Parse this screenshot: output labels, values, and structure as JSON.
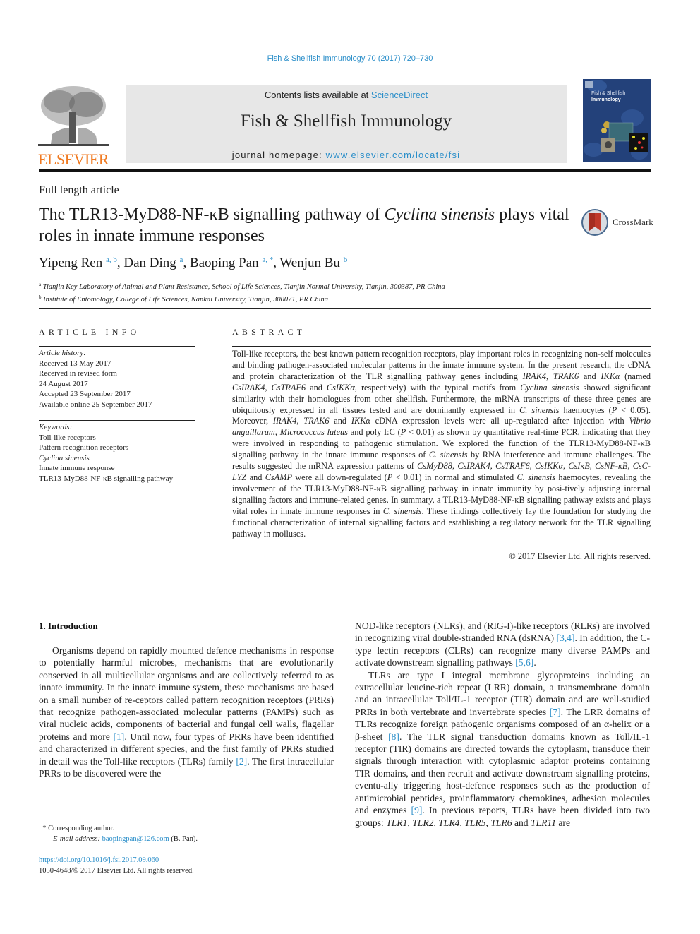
{
  "running_head": "Fish & Shellfish Immunology 70 (2017) 720–730",
  "header": {
    "publisher_logo_text": "ELSEVIER",
    "contents_prefix": "Contents lists available at ",
    "contents_link": "ScienceDirect",
    "journal_name": "Fish & Shellfish Immunology",
    "homepage_prefix": "journal homepage: ",
    "homepage_link": "www.elsevier.com/locate/fsi",
    "cover_title_line1": "Fish & Shellfish",
    "cover_title_line2": "Immunology"
  },
  "article": {
    "type": "Full length article",
    "title_part1": "The TLR13-MyD88-NF-κB signalling pathway of ",
    "title_italic": "Cyclina sinensis",
    "title_part2": " plays vital roles in innate immune responses",
    "crossmark_label": "CrossMark",
    "authors": [
      {
        "name": "Yipeng Ren",
        "sup": "a, b",
        "sep": ", "
      },
      {
        "name": "Dan Ding",
        "sup": "a",
        "sep": ", "
      },
      {
        "name": "Baoping Pan",
        "sup": "a, *",
        "sep": ", "
      },
      {
        "name": "Wenjun Bu",
        "sup": "b",
        "sep": ""
      }
    ],
    "affiliations": [
      {
        "mark": "a",
        "text": "Tianjin Key Laboratory of Animal and Plant Resistance, School of Life Sciences, Tianjin Normal University, Tianjin, 300387, PR China"
      },
      {
        "mark": "b",
        "text": "Institute of Entomology, College of Life Sciences, Nankai University, Tianjin, 300071, PR China"
      }
    ]
  },
  "article_info": {
    "heading": "ARTICLE INFO",
    "history_label": "Article history:",
    "history": [
      "Received 13 May 2017",
      "Received in revised form",
      "24 August 2017",
      "Accepted 23 September 2017",
      "Available online 25 September 2017"
    ],
    "keywords_label": "Keywords:",
    "keywords": [
      "Toll-like receptors",
      "Pattern recognition receptors",
      "Cyclina sinensis",
      "Innate immune response",
      "TLR13-MyD88-NF-κB signalling pathway"
    ]
  },
  "abstract": {
    "heading": "ABSTRACT",
    "text_html": "Toll-like receptors, the best known pattern recognition receptors, play important roles in recognizing non-self molecules and binding pathogen-associated molecular patterns in the innate immune system. In the present research, the cDNA and protein characterization of the TLR signalling pathway genes including <i>IRAK4</i>, <i>TRAK6</i> and <i>IKKα</i> (named <i>CsIRAK4</i>, <i>CsTRAF6</i> and <i>CsIKKα</i>, respectively) with the typical motifs from <i>Cyclina sinensis</i> showed significant similarity with their homologues from other shellfish. Furthermore, the mRNA transcripts of these three genes are ubiquitously expressed in all tissues tested and are dominantly expressed in <i>C. sinensis</i> haemocytes (<i>P</i> &lt; 0.05). Moreover, <i>IRAK4</i>, <i>TRAK6</i> and <i>IKKα</i> cDNA expression levels were all up-regulated after injection with <i>Vibrio anguillarum</i>, <i>Micrococcus luteus</i> and poly I:C (<i>P</i> &lt; 0.01) as shown by quantitative real-time PCR, indicating that they were involved in responding to pathogenic stimulation. We explored the function of the TLR13-MyD88-NF-κB signalling pathway in the innate immune responses of <i>C. sinensis</i> by RNA interference and immune challenges. The results suggested the mRNA expression patterns of <i>CsMyD88</i>, <i>CsIRAK4</i>, <i>CsTRAF6</i>, <i>CsIKKα</i>, <i>CsIκB</i>, <i>CsNF-κB</i>, <i>CsC-LYZ</i> and <i>CsAMP</i> were all down-regulated (<i>P</i> &lt; 0.01) in normal and stimulated <i>C. sinensis</i> haemocytes, revealing the involvement of the TLR13-MyD88-NF-κB signalling pathway in innate immunity by posi-tively adjusting internal signalling factors and immune-related genes. In summary, a TLR13-MyD88-NF-κB signalling pathway exists and plays vital roles in innate immune responses in <i>C. sinensis</i>. These findings collectively lay the foundation for studying the functional characterization of internal signalling factors and establishing a regulatory network for the TLR signalling pathway in molluscs.",
    "copyright": "© 2017 Elsevier Ltd. All rights reserved."
  },
  "body": {
    "section_heading": "1.  Introduction",
    "left_col_html": "Organisms depend on rapidly mounted defence mechanisms in response to potentially harmful microbes, mechanisms that are evolutionarily conserved in all multicellular organisms and are collectively referred to as innate immunity. In the innate immune system, these mechanisms are based on a small number of re-ceptors called pattern recognition receptors (PRRs) that recognize pathogen-associated molecular patterns (PAMPs) such as viral nucleic acids, components of bacterial and fungal cell walls, flagellar proteins and more <span class=\"link\">[1]</span>. Until now, four types of PRRs have been identified and characterized in different species, and the first family of PRRs studied in detail was the Toll-like receptors (TLRs) family <span class=\"link\">[2]</span>. The first intracellular PRRs to be discovered were the",
    "right_col_p1_html": "NOD-like receptors (NLRs), and (RIG-I)-like receptors (RLRs) are involved in recognizing viral double-stranded RNA (dsRNA) <span class=\"link\">[3,4]</span>. In addition, the C-type lectin receptors (CLRs) can recognize many diverse PAMPs and activate downstream signalling pathways <span class=\"link\">[5,6]</span>.",
    "right_col_p2_html": "TLRs are type I integral membrane glycoproteins including an extracellular leucine-rich repeat (LRR) domain, a transmembrane domain and an intracellular Toll/IL-1 receptor (TIR) domain and are well-studied PRRs in both vertebrate and invertebrate species <span class=\"link\">[7]</span>. The LRR domains of TLRs recognize foreign pathogenic organisms composed of an α-helix or a β-sheet <span class=\"link\">[8]</span>. The TLR signal transduction domains known as Toll/IL-1 receptor (TIR) domains are directed towards the cytoplasm, transduce their signals through interaction with cytoplasmic adaptor proteins containing TIR domains, and then recruit and activate downstream signalling proteins, eventu-ally triggering host-defence responses such as the production of antimicrobial peptides, proinflammatory chemokines, adhesion molecules and enzymes <span class=\"link\">[9]</span>. In previous reports, TLRs have been divided into two groups: <i>TLR1</i>, <i>TLR2</i>, <i>TLR4</i>, <i>TLR5</i>, <i>TLR6</i> and <i>TLR11</i> are"
  },
  "footnotes": {
    "corresponding_mark": "*",
    "corresponding_text": "Corresponding author.",
    "email_label": "E-mail address:",
    "email": "baopingpan@126.com",
    "email_suffix": " (B. Pan).",
    "doi": "https://doi.org/10.1016/j.fsi.2017.09.060",
    "issn_line": "1050-4648/© 2017 Elsevier Ltd. All rights reserved."
  },
  "colors": {
    "link": "#2a8ec9",
    "elsevier_orange": "#f07a21",
    "header_box": "#e7e7e7",
    "cover_blue": "#23417a"
  }
}
